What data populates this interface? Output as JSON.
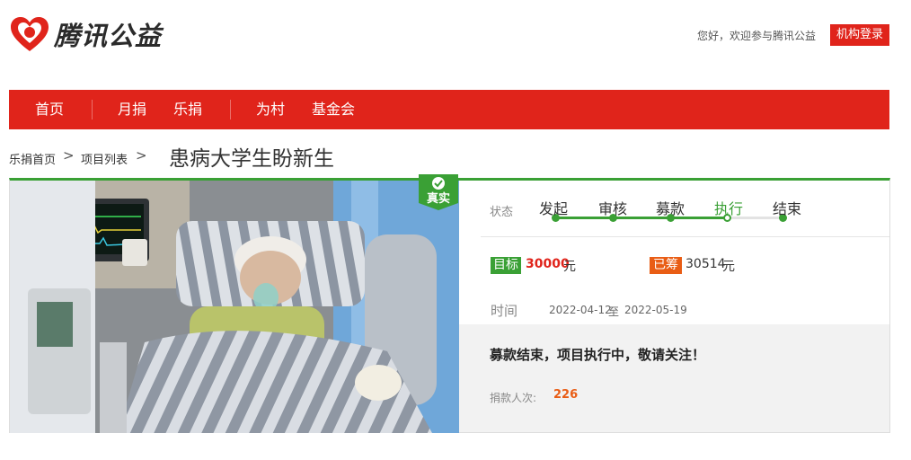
{
  "brand": {
    "name": "腾讯公益",
    "color": "#e0241b"
  },
  "header": {
    "greeting": "您好，欢迎参与腾讯公益",
    "login_label": "机构登录"
  },
  "nav": {
    "items": [
      "首页",
      "月捐",
      "乐捐",
      "为村",
      "基金会"
    ]
  },
  "breadcrumb": {
    "items": [
      "乐捐首页",
      "项目列表"
    ],
    "separator": ">"
  },
  "project": {
    "title": "患病大学生盼新生",
    "verified_badge": "真实",
    "status": {
      "label": "状态",
      "steps": [
        "发起",
        "审核",
        "募款",
        "执行",
        "结束"
      ],
      "current_step": "执行"
    },
    "goal": {
      "label": "目标",
      "amount": "30000",
      "unit": "元"
    },
    "raised": {
      "label": "已筹",
      "amount": "30514",
      "unit": "元"
    },
    "time": {
      "label": "时间",
      "start": "2022-04-12",
      "to": "至",
      "end": "2022-05-19"
    },
    "notice": "募款结束，项目执行中，敬请关注！",
    "donors": {
      "label": "捐款人次:",
      "count": "226"
    },
    "photo_icon": "patient-photo"
  },
  "colors": {
    "nav_red": "#e0241b",
    "green": "#3aa035",
    "orange": "#e95d15"
  }
}
